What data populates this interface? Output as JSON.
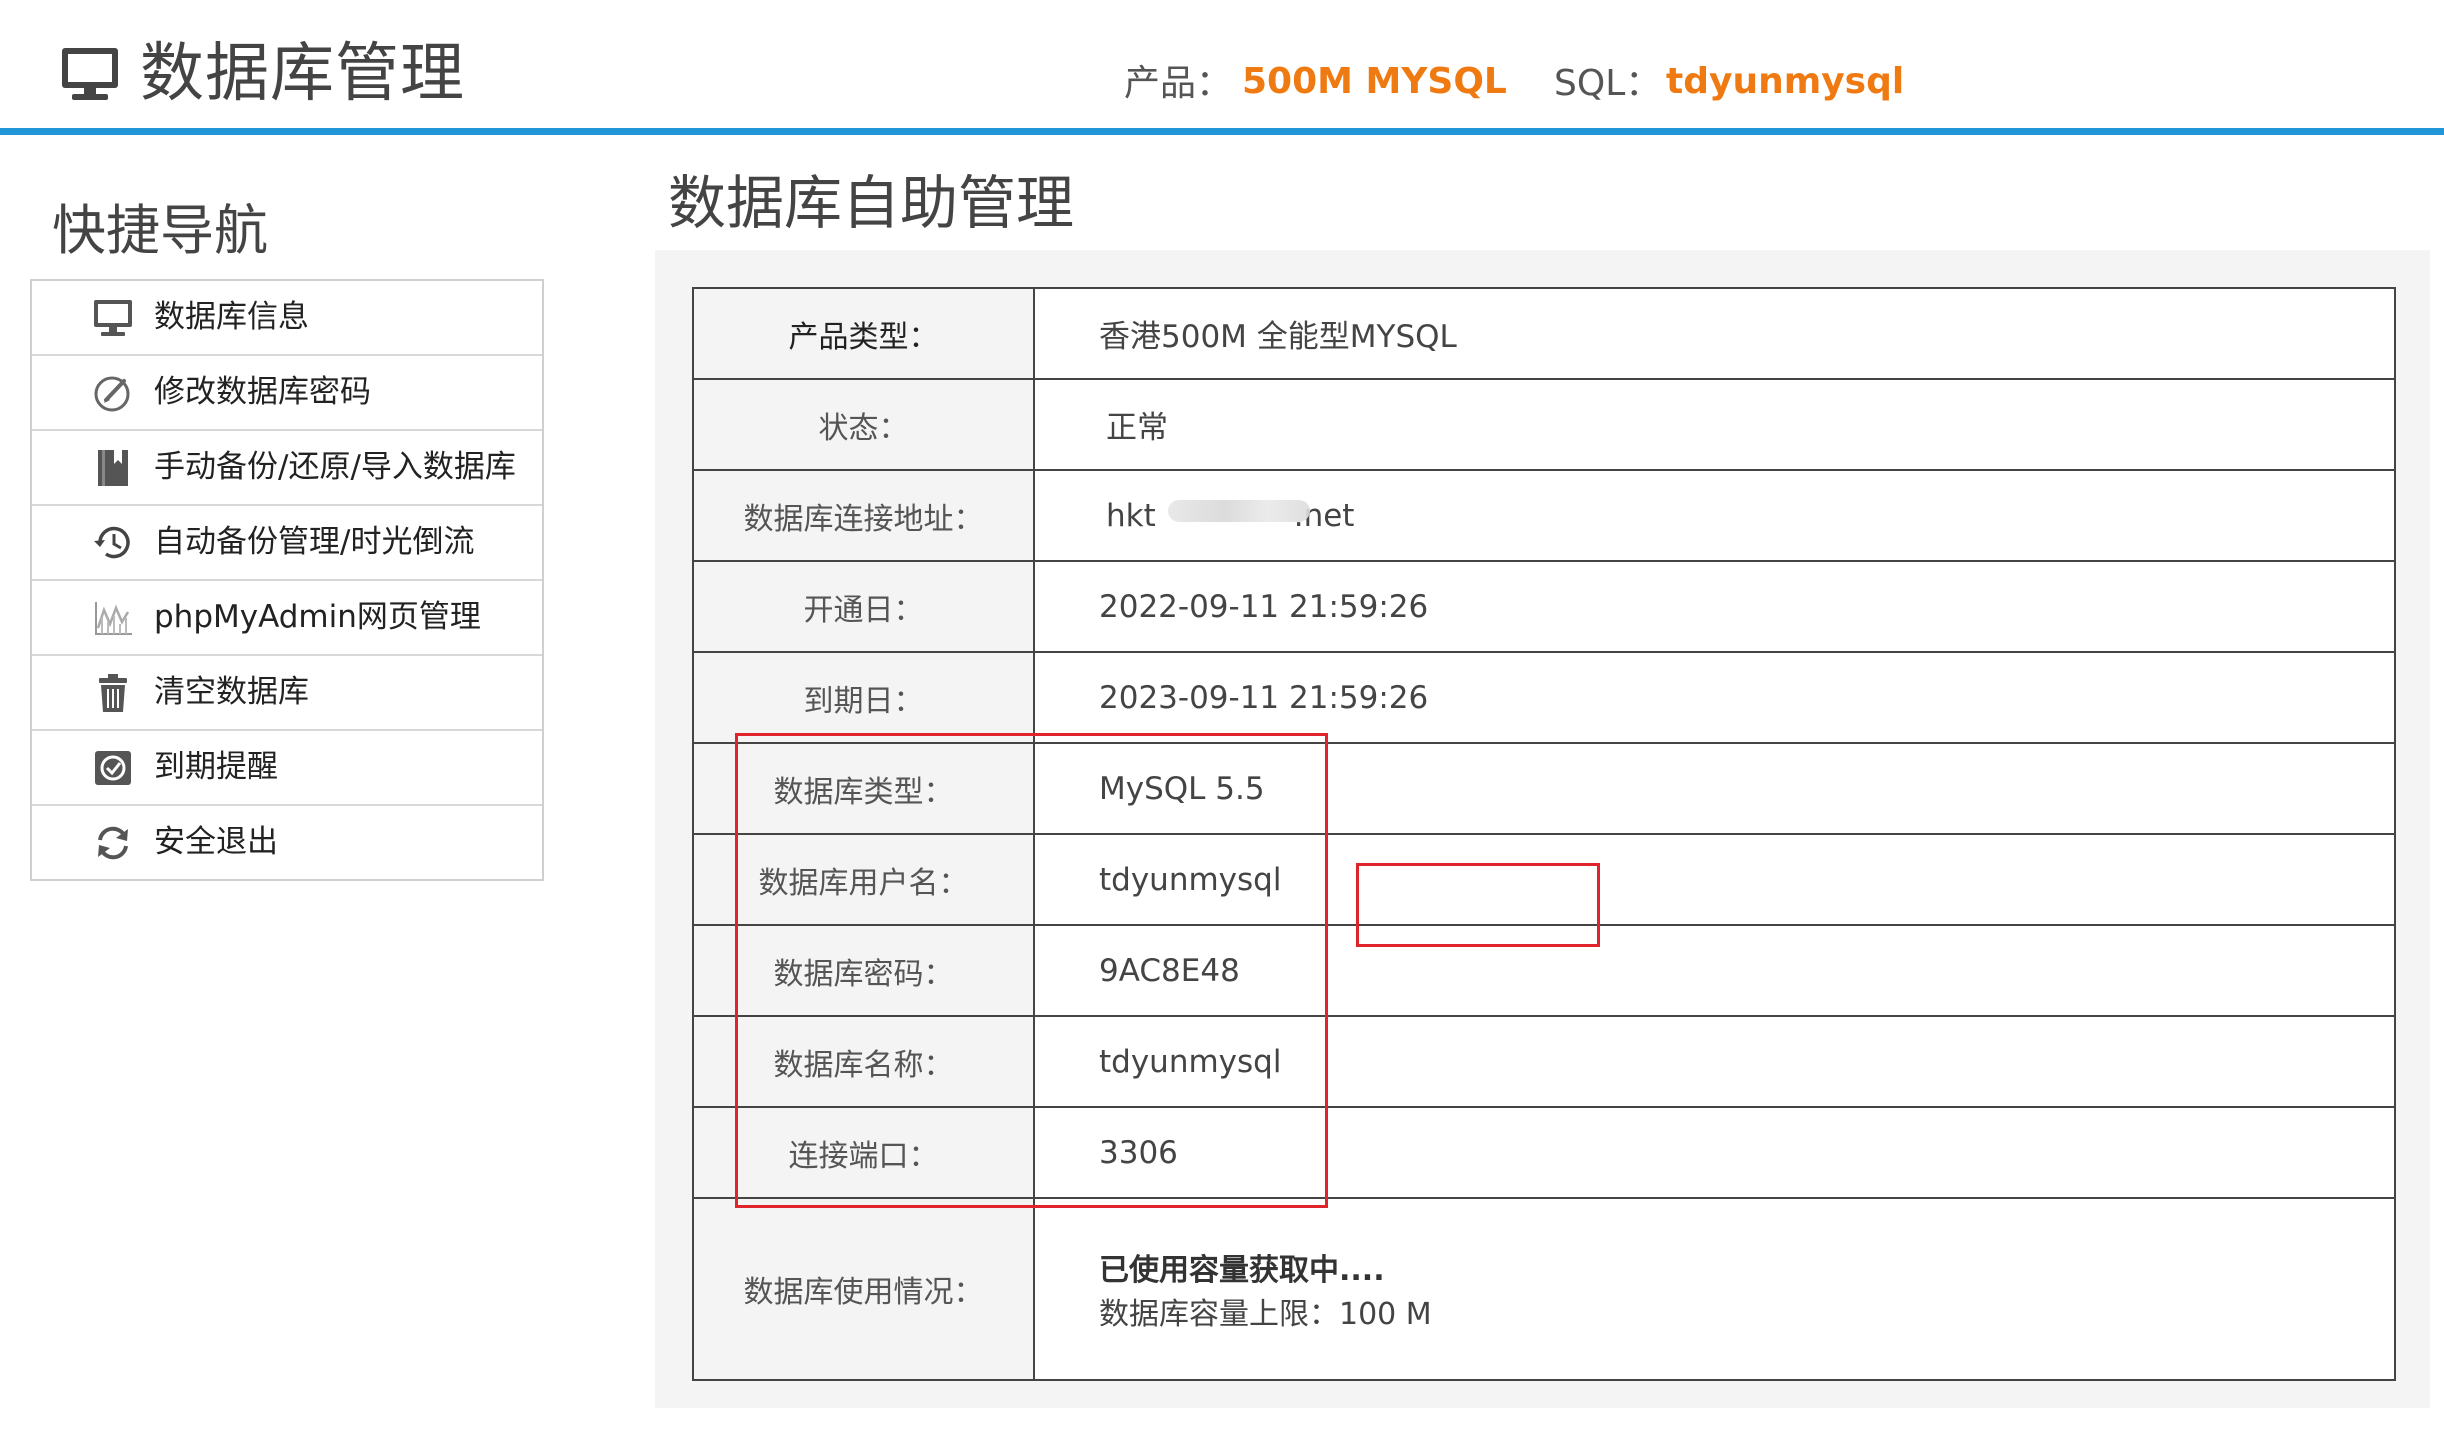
{
  "header": {
    "title": "数据库管理",
    "product_label": "产品：",
    "product_value": "500M MYSQL",
    "sql_label": "SQL：",
    "sql_value": "tdyunmysql"
  },
  "sidebar": {
    "title": "快捷导航",
    "items": [
      {
        "label": "数据库信息",
        "icon": "monitor-icon"
      },
      {
        "label": "修改数据库密码",
        "icon": "edit-icon"
      },
      {
        "label": "手动备份/还原/导入数据库",
        "icon": "book-icon"
      },
      {
        "label": "自动备份管理/时光倒流",
        "icon": "clock-history-icon"
      },
      {
        "label": "phpMyAdmin网页管理",
        "icon": "chart-icon"
      },
      {
        "label": "清空数据库",
        "icon": "trash-icon"
      },
      {
        "label": "到期提醒",
        "icon": "reminder-icon"
      },
      {
        "label": "安全退出",
        "icon": "refresh-icon"
      }
    ]
  },
  "main": {
    "title": "数据库自助管理",
    "rows": [
      {
        "key": "产品类型：",
        "value": "香港500M 全能型MYSQL"
      },
      {
        "key": "状态：",
        "value": "正常"
      },
      {
        "key": "数据库连接地址：",
        "value": "hkt              .net"
      },
      {
        "key": "开通日：",
        "value": "2022-09-11 21:59:26"
      },
      {
        "key": "到期日：",
        "value": "2023-09-11 21:59:26"
      },
      {
        "key": "数据库类型：",
        "value": "MySQL 5.5"
      },
      {
        "key": "数据库用户名：",
        "value": "tdyunmysql"
      },
      {
        "key": "数据库密码：",
        "value": "9AC8E48"
      },
      {
        "key": "数据库名称：",
        "value": "tdyunmysql"
      },
      {
        "key": "连接端口：",
        "value": "3306"
      }
    ],
    "usage": {
      "key": "数据库使用情况：",
      "status": "已使用容量获取中....",
      "limit": "数据库容量上限：100 M"
    }
  },
  "colors": {
    "accent": "#2196d6",
    "highlight": "#f07a12",
    "annotation": "#e0242c"
  }
}
